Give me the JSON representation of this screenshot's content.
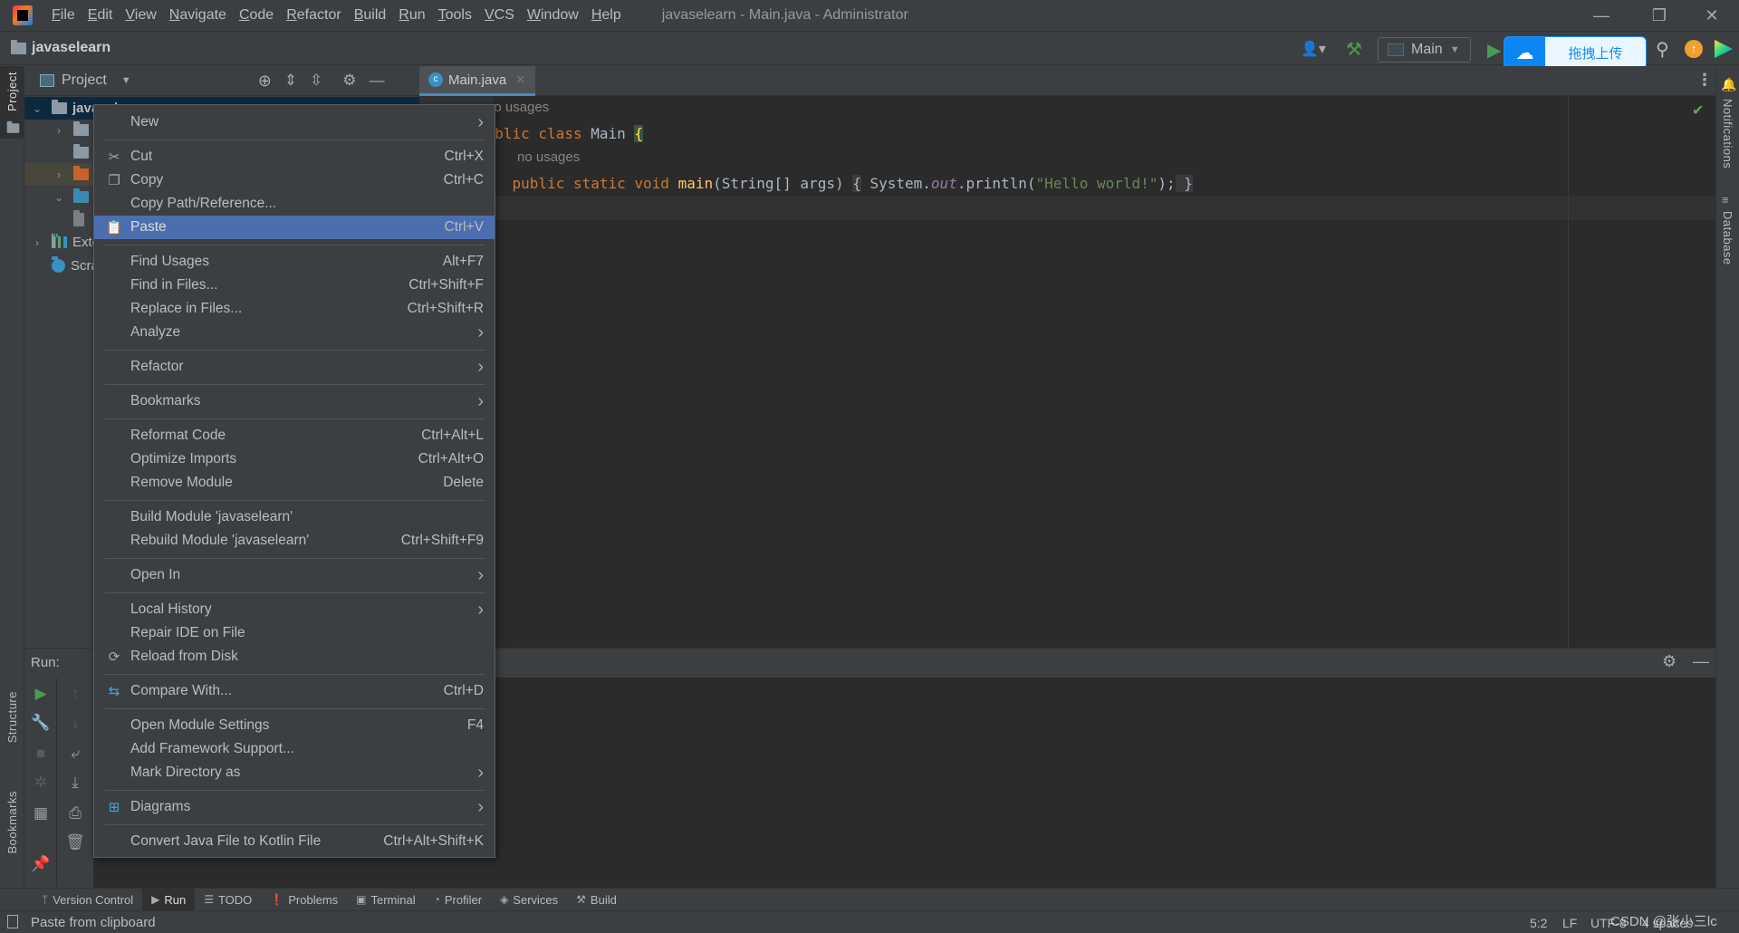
{
  "titlebar": {
    "menus": [
      "File",
      "Edit",
      "View",
      "Navigate",
      "Code",
      "Refactor",
      "Build",
      "Run",
      "Tools",
      "VCS",
      "Window",
      "Help"
    ],
    "window_title": "javaselearn - Main.java - Administrator"
  },
  "navbar": {
    "project_name": "javaselearn",
    "run_config": "Main",
    "upload_button": "拖拽上传"
  },
  "left_stripe": {
    "top": "Project",
    "structure": "Structure",
    "bookmarks": "Bookmarks"
  },
  "right_stripe": {
    "notifications": "Notifications",
    "database": "Database"
  },
  "project_panel": {
    "title": "Project",
    "tree": [
      {
        "label": "javaselearn",
        "type": "module",
        "expanded": true
      },
      {
        "label": "",
        "type": "folder",
        "expanded": false
      },
      {
        "label": "",
        "type": "folder"
      },
      {
        "label": "",
        "type": "folder-excluded",
        "expanded": false
      },
      {
        "label": "",
        "type": "folder-source",
        "expanded": true
      },
      {
        "label": "",
        "type": "file"
      },
      {
        "label": "External Libraries",
        "type": "libraries",
        "expanded": false
      },
      {
        "label": "Scratches and Consoles",
        "type": "scratches"
      }
    ]
  },
  "editor": {
    "tab": "Main.java",
    "hint1": "no usages",
    "hint2": "no usages",
    "line1": {
      "kw": "public class ",
      "name": "Main ",
      "brace": "{"
    },
    "line2": {
      "indent": "    ",
      "kw": "public static void ",
      "fn": "main",
      "params": "(String[] args) ",
      "ob": "{",
      "sys": " System.",
      "out": "out",
      "call": ".println(",
      "str": "\"Hello world!\"",
      "end": ");",
      "semi": "",
      "cb": " }"
    }
  },
  "run_panel": {
    "label": "Run:"
  },
  "context_menu": {
    "groups": [
      [
        {
          "label": "New",
          "submenu": true
        }
      ],
      [
        {
          "label": "Cut",
          "shortcut": "Ctrl+X",
          "icon": "scissors-icon"
        },
        {
          "label": "Copy",
          "shortcut": "Ctrl+C",
          "icon": "copy-icon"
        },
        {
          "label": "Copy Path/Reference..."
        },
        {
          "label": "Paste",
          "shortcut": "Ctrl+V",
          "icon": "clipboard-icon",
          "selected": true
        }
      ],
      [
        {
          "label": "Find Usages",
          "shortcut": "Alt+F7"
        },
        {
          "label": "Find in Files...",
          "shortcut": "Ctrl+Shift+F"
        },
        {
          "label": "Replace in Files...",
          "shortcut": "Ctrl+Shift+R"
        },
        {
          "label": "Analyze",
          "submenu": true
        }
      ],
      [
        {
          "label": "Refactor",
          "submenu": true
        }
      ],
      [
        {
          "label": "Bookmarks",
          "submenu": true
        }
      ],
      [
        {
          "label": "Reformat Code",
          "shortcut": "Ctrl+Alt+L"
        },
        {
          "label": "Optimize Imports",
          "shortcut": "Ctrl+Alt+O"
        },
        {
          "label": "Remove Module",
          "shortcut": "Delete"
        }
      ],
      [
        {
          "label": "Build Module 'javaselearn'"
        },
        {
          "label": "Rebuild Module 'javaselearn'",
          "shortcut": "Ctrl+Shift+F9"
        }
      ],
      [
        {
          "label": "Open In",
          "submenu": true
        }
      ],
      [
        {
          "label": "Local History",
          "submenu": true
        },
        {
          "label": "Repair IDE on File"
        },
        {
          "label": "Reload from Disk",
          "icon": "reload-icon"
        }
      ],
      [
        {
          "label": "Compare With...",
          "shortcut": "Ctrl+D",
          "icon": "compare-icon"
        }
      ],
      [
        {
          "label": "Open Module Settings",
          "shortcut": "F4"
        },
        {
          "label": "Add Framework Support..."
        },
        {
          "label": "Mark Directory as",
          "submenu": true
        }
      ],
      [
        {
          "label": "Diagrams",
          "submenu": true,
          "icon": "diagram-icon"
        }
      ],
      [
        {
          "label": "Convert Java File to Kotlin File",
          "shortcut": "Ctrl+Alt+Shift+K"
        }
      ]
    ]
  },
  "tool_strip": [
    {
      "label": "Version Control",
      "icon": "vcs-icon"
    },
    {
      "label": "Run",
      "icon": "run-icon",
      "selected": true
    },
    {
      "label": "TODO",
      "icon": "list-icon"
    },
    {
      "label": "Problems",
      "icon": "problems-icon"
    },
    {
      "label": "Terminal",
      "icon": "terminal-icon"
    },
    {
      "label": "Profiler",
      "icon": "profiler-icon"
    },
    {
      "label": "Services",
      "icon": "services-icon"
    },
    {
      "label": "Build",
      "icon": "hammer-icon"
    }
  ],
  "status_bar": {
    "message": "Paste from clipboard",
    "position": "5:2",
    "line_sep": "LF",
    "encoding": "UTF-8",
    "indent": "4 spaces",
    "watermark": "CSDN @张小三lc"
  },
  "colors": {
    "selection": "#4b6eaf",
    "editor_bg": "#2b2b2b",
    "panel_bg": "#3c3f41",
    "accent_blue": "#0b87f5"
  }
}
